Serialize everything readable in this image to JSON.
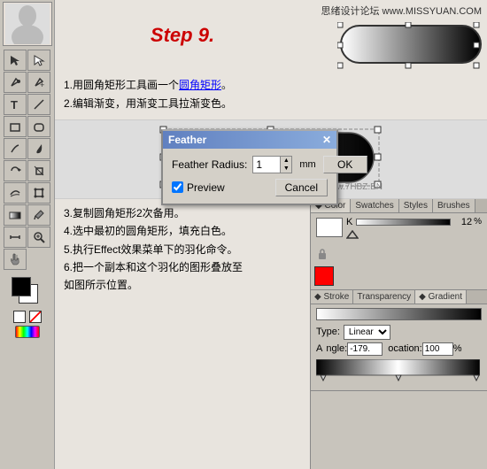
{
  "toolbar": {
    "tools": [
      "✦",
      "⊹",
      "↖",
      "⊕",
      "T",
      "✏",
      "✒",
      "✂",
      "⟳",
      "◈",
      "▣",
      "⊞",
      "∿",
      "↕",
      "◐",
      "⊙",
      "☿",
      "❒",
      "✦",
      "⊕"
    ]
  },
  "header": {
    "watermark": "思绪设计论坛 www.MISSYUAN.COM",
    "step_title": "Step 9."
  },
  "instructions_top": {
    "line1": "1.用圆角矩形工具画一个",
    "line1_link": "圆角矩形",
    "line1_end": "。",
    "line2": "2.编辑渐变，用渐变工具拉渐变色。"
  },
  "feather_dialog": {
    "title": "Feather",
    "radius_label": "Feather Radius:",
    "radius_value": "1",
    "radius_unit": "mm",
    "ok_label": "OK",
    "cancel_label": "Cancel",
    "preview_label": "Preview",
    "preview_checked": true
  },
  "right_panel": {
    "tabs": [
      "Color",
      "Swatches",
      "Styles",
      "Brushes"
    ],
    "k_label": "K",
    "k_value": "12",
    "percent": "%"
  },
  "stroke_panel": {
    "tabs": [
      "Stroke",
      "Transparency",
      "Gradient"
    ],
    "type_label": "Type:",
    "type_value": "Linear",
    "angle_label": "ngle:",
    "angle_value": "-179.",
    "location_label": "ocation:",
    "location_value": "100",
    "location_unit": "%"
  },
  "instructions_bottom": {
    "line3": "3.复制圆角矩形2次备用。",
    "line4": "4.选中最初的圆角矩形，填充白色。",
    "line5": "5.执行Effect效果菜单下的羽化命令。",
    "line6": "6.把一个副本和这个羽化的图形叠放至",
    "line6_2": "如图所示位置。"
  },
  "colors": {
    "accent_red": "#cc0000",
    "dialog_title_start": "#6080c0",
    "dialog_title_end": "#8aacdc"
  }
}
